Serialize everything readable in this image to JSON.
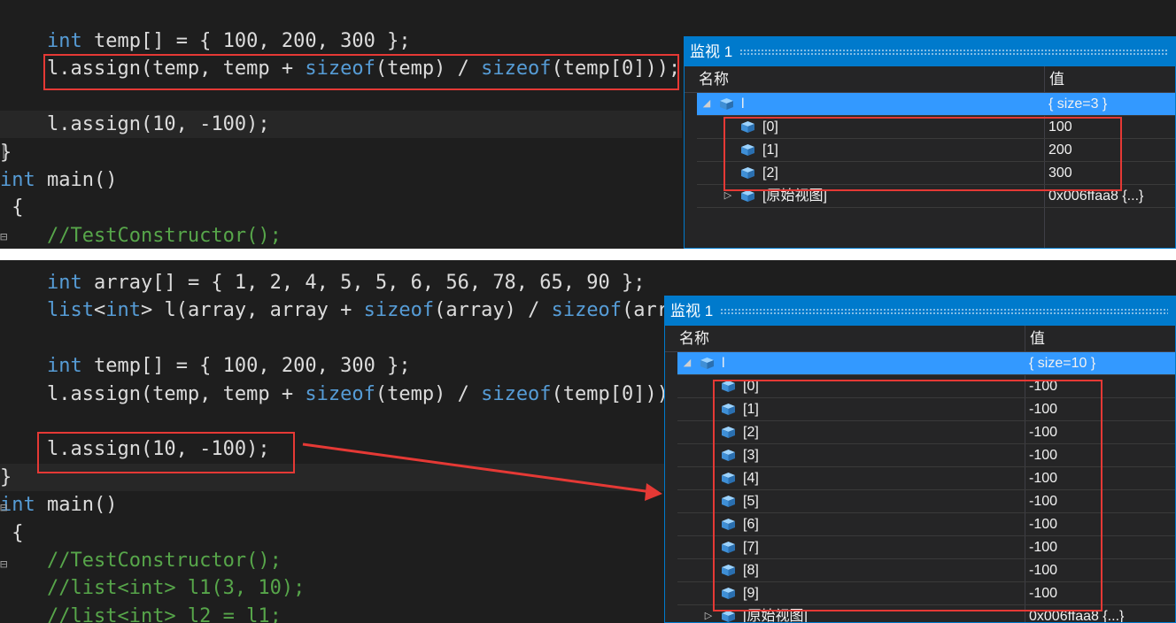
{
  "top_editor": {
    "lines": [
      {
        "tokens": [
          {
            "t": "    ",
            "c": "plain"
          },
          {
            "t": "int",
            "c": "keyword"
          },
          {
            "t": " temp[] = { 100, 200, 300 };",
            "c": "plain"
          }
        ]
      },
      {
        "tokens": [
          {
            "t": "    l.assign(temp, temp + ",
            "c": "plain"
          },
          {
            "t": "sizeof",
            "c": "keyword"
          },
          {
            "t": "(temp) / ",
            "c": "plain"
          },
          {
            "t": "sizeof",
            "c": "keyword"
          },
          {
            "t": "(temp[0]));",
            "c": "plain"
          }
        ]
      },
      {
        "tokens": [
          {
            "t": "",
            "c": "plain"
          }
        ]
      },
      {
        "tokens": [
          {
            "t": "    l.assign(10, -100);",
            "c": "plain"
          }
        ]
      },
      {
        "tokens": [
          {
            "t": "}",
            "c": "plain"
          }
        ]
      },
      {
        "tokens": [
          {
            "t": "int",
            "c": "keyword"
          },
          {
            "t": " main()",
            "c": "plain"
          }
        ]
      },
      {
        "tokens": [
          {
            "t": " {",
            "c": "plain"
          }
        ]
      },
      {
        "tokens": [
          {
            "t": "    ",
            "c": "plain"
          },
          {
            "t": "//TestConstructor();",
            "c": "comment"
          }
        ]
      }
    ]
  },
  "bottom_editor": {
    "lines": [
      {
        "tokens": [
          {
            "t": "    ",
            "c": "plain"
          },
          {
            "t": "int",
            "c": "keyword"
          },
          {
            "t": " array[] = { 1, 2, 4, 5, 5, 6, 56, 78, 65, 90 };",
            "c": "plain"
          }
        ]
      },
      {
        "tokens": [
          {
            "t": "    ",
            "c": "plain"
          },
          {
            "t": "list",
            "c": "keyword"
          },
          {
            "t": "<",
            "c": "plain"
          },
          {
            "t": "int",
            "c": "keyword"
          },
          {
            "t": "> l(array, array + ",
            "c": "plain"
          },
          {
            "t": "sizeof",
            "c": "keyword"
          },
          {
            "t": "(array) / ",
            "c": "plain"
          },
          {
            "t": "sizeof",
            "c": "keyword"
          },
          {
            "t": "(arr",
            "c": "plain"
          }
        ]
      },
      {
        "tokens": [
          {
            "t": "",
            "c": "plain"
          }
        ]
      },
      {
        "tokens": [
          {
            "t": "    ",
            "c": "plain"
          },
          {
            "t": "int",
            "c": "keyword"
          },
          {
            "t": " temp[] = { 100, 200, 300 };",
            "c": "plain"
          }
        ]
      },
      {
        "tokens": [
          {
            "t": "    l.assign(temp, temp + ",
            "c": "plain"
          },
          {
            "t": "sizeof",
            "c": "keyword"
          },
          {
            "t": "(temp) / ",
            "c": "plain"
          },
          {
            "t": "sizeof",
            "c": "keyword"
          },
          {
            "t": "(temp[0]))",
            "c": "plain"
          }
        ]
      },
      {
        "tokens": [
          {
            "t": "",
            "c": "plain"
          }
        ]
      },
      {
        "tokens": [
          {
            "t": "    l.assign(10, -100);",
            "c": "plain"
          }
        ]
      },
      {
        "tokens": [
          {
            "t": "}",
            "c": "plain"
          }
        ]
      },
      {
        "tokens": [
          {
            "t": "int",
            "c": "keyword"
          },
          {
            "t": " main()",
            "c": "plain"
          }
        ]
      },
      {
        "tokens": [
          {
            "t": " {",
            "c": "plain"
          }
        ]
      },
      {
        "tokens": [
          {
            "t": "    ",
            "c": "plain"
          },
          {
            "t": "//TestConstructor();",
            "c": "comment"
          }
        ]
      },
      {
        "tokens": [
          {
            "t": "    ",
            "c": "plain"
          },
          {
            "t": "//list<int> l1(3, 10);",
            "c": "comment"
          }
        ]
      },
      {
        "tokens": [
          {
            "t": "    ",
            "c": "plain"
          },
          {
            "t": "//list<int> l2 = l1;",
            "c": "comment"
          }
        ]
      }
    ]
  },
  "watch_top": {
    "title": "监视 1",
    "col_name": "名称",
    "col_value": "值",
    "rows": [
      {
        "expander": "◢",
        "name": "l",
        "value": "{ size=3 }",
        "selected": true
      },
      {
        "expander": "",
        "name": "[0]",
        "value": "100",
        "selected": false
      },
      {
        "expander": "",
        "name": "[1]",
        "value": "200",
        "selected": false
      },
      {
        "expander": "",
        "name": "[2]",
        "value": "300",
        "selected": false
      },
      {
        "expander": "▷",
        "name": "[原始视图]",
        "value": "0x006ffaa8 {...}",
        "selected": false
      }
    ]
  },
  "watch_bottom": {
    "title": "监视 1",
    "col_name": "名称",
    "col_value": "值",
    "rows": [
      {
        "expander": "◢",
        "name": "l",
        "value": "{ size=10 }",
        "selected": true
      },
      {
        "expander": "",
        "name": "[0]",
        "value": "-100",
        "selected": false
      },
      {
        "expander": "",
        "name": "[1]",
        "value": "-100",
        "selected": false
      },
      {
        "expander": "",
        "name": "[2]",
        "value": "-100",
        "selected": false
      },
      {
        "expander": "",
        "name": "[3]",
        "value": "-100",
        "selected": false
      },
      {
        "expander": "",
        "name": "[4]",
        "value": "-100",
        "selected": false
      },
      {
        "expander": "",
        "name": "[5]",
        "value": "-100",
        "selected": false
      },
      {
        "expander": "",
        "name": "[6]",
        "value": "-100",
        "selected": false
      },
      {
        "expander": "",
        "name": "[7]",
        "value": "-100",
        "selected": false
      },
      {
        "expander": "",
        "name": "[8]",
        "value": "-100",
        "selected": false
      },
      {
        "expander": "",
        "name": "[9]",
        "value": "-100",
        "selected": false
      },
      {
        "expander": "▷",
        "name": "[原始视图]",
        "value": "0x006ffaa8 {...}",
        "selected": false
      }
    ]
  },
  "icons": {
    "node": "variable-cube-icon",
    "fold": "collapse-marker-icon",
    "arrow": "red-arrow-icon"
  },
  "colors": {
    "editor_bg": "#1e1e1e",
    "keyword": "#569cd6",
    "comment": "#57a64a",
    "text": "#dcdcdc",
    "watch_title": "#007acc",
    "selection": "#3399ff",
    "highlight_box": "#e53935"
  }
}
